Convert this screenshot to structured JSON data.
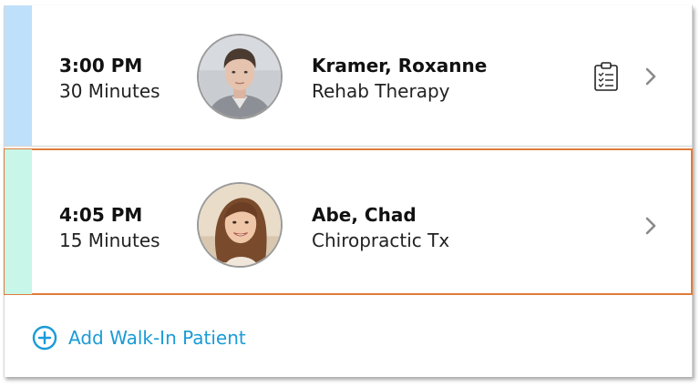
{
  "appointments": [
    {
      "time": "3:00 PM",
      "duration": "30 Minutes",
      "patient": "Kramer, Roxanne",
      "service": "Rehab Therapy",
      "accent_color": "#bfe0fa",
      "has_clipboard": true,
      "selected": false,
      "avatar_icon": "avatar-photo-man"
    },
    {
      "time": "4:05 PM",
      "duration": "15 Minutes",
      "patient": "Abe, Chad",
      "service": "Chiropractic Tx",
      "accent_color": "#c8f6e8",
      "has_clipboard": false,
      "selected": true,
      "avatar_icon": "avatar-photo-woman"
    }
  ],
  "add_walkin": {
    "label": "Add Walk-In Patient",
    "icon": "plus-circle-icon",
    "color": "#1a9bd7"
  },
  "colors": {
    "selected_outline": "#e07b39"
  }
}
